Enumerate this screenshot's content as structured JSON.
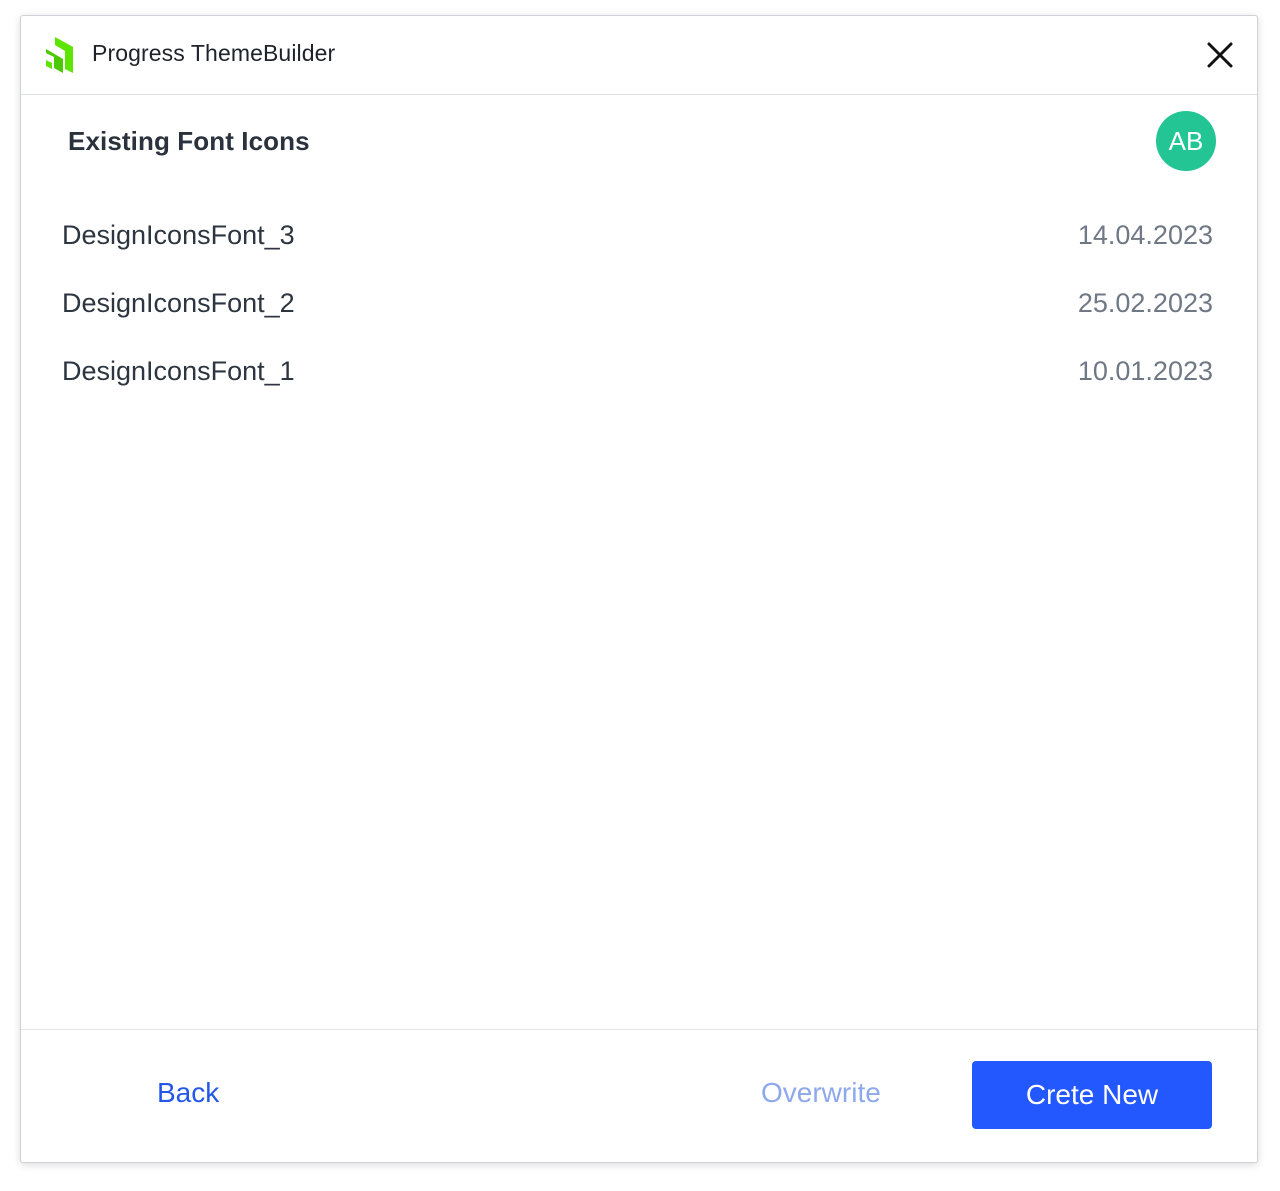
{
  "app": {
    "title": "Progress ThemeBuilder",
    "logo_icon": "progress-logo-icon",
    "close_icon": "close-icon"
  },
  "section": {
    "title": "Existing Font Icons"
  },
  "user": {
    "initials": "AB",
    "avatar_color": "#23c595"
  },
  "fonts": [
    {
      "name": "DesignIconsFont_3",
      "date": "14.04.2023"
    },
    {
      "name": "DesignIconsFont_2",
      "date": "25.02.2023"
    },
    {
      "name": "DesignIconsFont_1",
      "date": "10.01.2023"
    }
  ],
  "footer": {
    "back_label": "Back",
    "overwrite_label": "Overwrite",
    "create_label": "Crete New"
  },
  "colors": {
    "primary": "#2458ff",
    "link": "#2357e8",
    "disabled_link": "#8ea8ee",
    "logo_green": "#5ce500"
  }
}
